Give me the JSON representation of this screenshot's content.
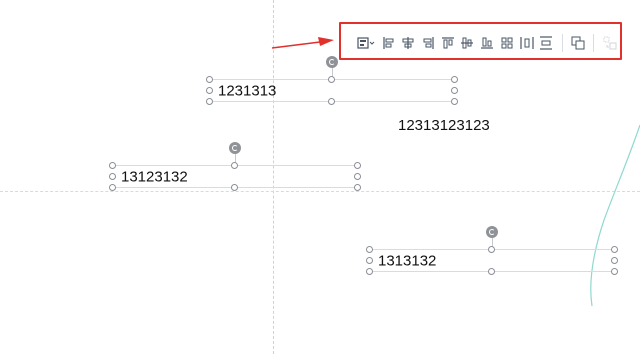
{
  "toolbar": {
    "buttons": [
      {
        "name": "align-dropdown-icon"
      },
      {
        "name": "align-left-icon"
      },
      {
        "name": "align-center-horizontal-icon"
      },
      {
        "name": "align-right-icon"
      },
      {
        "name": "align-top-icon"
      },
      {
        "name": "align-middle-vertical-icon"
      },
      {
        "name": "align-bottom-icon"
      },
      {
        "name": "distribute-grid-icon"
      },
      {
        "name": "distribute-horizontal-icon"
      },
      {
        "name": "distribute-vertical-icon"
      },
      {
        "name": "group-icon"
      },
      {
        "name": "ungroup-icon"
      }
    ],
    "highlight_color": "#e0312c"
  },
  "canvas": {
    "textboxes": [
      {
        "text": "1231313"
      },
      {
        "text": "13123132"
      },
      {
        "text": "1313132"
      }
    ],
    "free_text": "12313123123",
    "guide_color": "#cfd3d7",
    "curve_color": "#8fd9cf"
  }
}
